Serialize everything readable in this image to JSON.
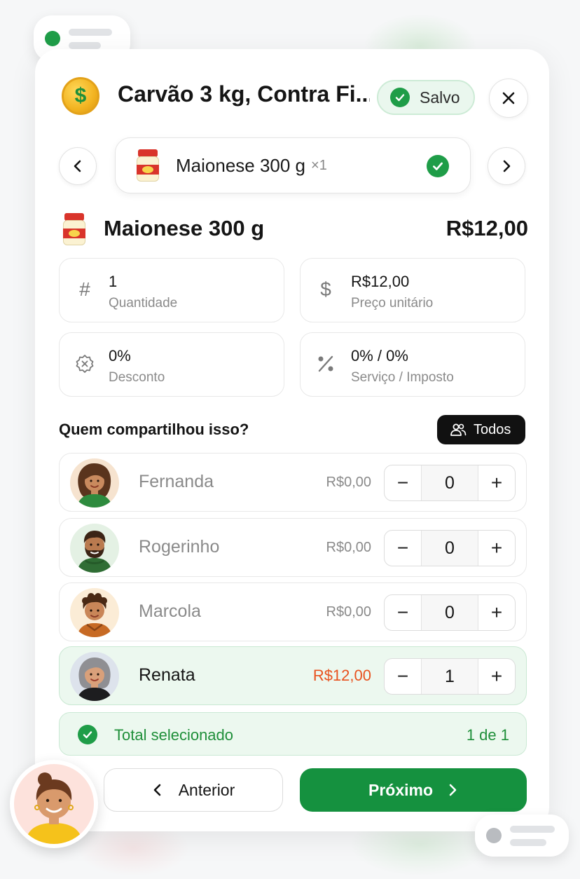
{
  "header": {
    "title": "Carvão 3 kg, Contra Fi...",
    "coin_icon": "dollar-coin-icon",
    "coin_symbol": "$",
    "saved_label": "Salvo"
  },
  "item_nav": {
    "item_name": "Maionese 300 g",
    "item_qty": "×1",
    "status": "selected"
  },
  "detail": {
    "name": "Maionese 300 g",
    "price": "R$12,00"
  },
  "stats": {
    "quantity": {
      "value": "1",
      "label": "Quantidade",
      "icon": "#"
    },
    "unit_price": {
      "value": "R$12,00",
      "label": "Preço unitário",
      "icon": "$"
    },
    "discount": {
      "value": "0%",
      "label": "Desconto"
    },
    "service_tax": {
      "value": "0% / 0%",
      "label": "Serviço / Imposto"
    }
  },
  "sharing": {
    "question": "Quem compartilhou isso?",
    "all_button": "Todos"
  },
  "people": [
    {
      "name": "Fernanda",
      "amount": "R$0,00",
      "count": "0",
      "selected": false
    },
    {
      "name": "Rogerinho",
      "amount": "R$0,00",
      "count": "0",
      "selected": false
    },
    {
      "name": "Marcola",
      "amount": "R$0,00",
      "count": "0",
      "selected": false
    },
    {
      "name": "Renata",
      "amount": "R$12,00",
      "count": "1",
      "selected": true
    }
  ],
  "stepper": {
    "minus": "−",
    "plus": "+"
  },
  "total": {
    "label": "Total selecionado",
    "count": "1 de 1"
  },
  "footer": {
    "prev_label": "Anterior",
    "next_label": "Próximo"
  },
  "colors": {
    "accent_green": "#15913f",
    "selected_bg": "#ecf8ef",
    "highlight_amount": "#e8521f",
    "dark_button": "#111111"
  }
}
